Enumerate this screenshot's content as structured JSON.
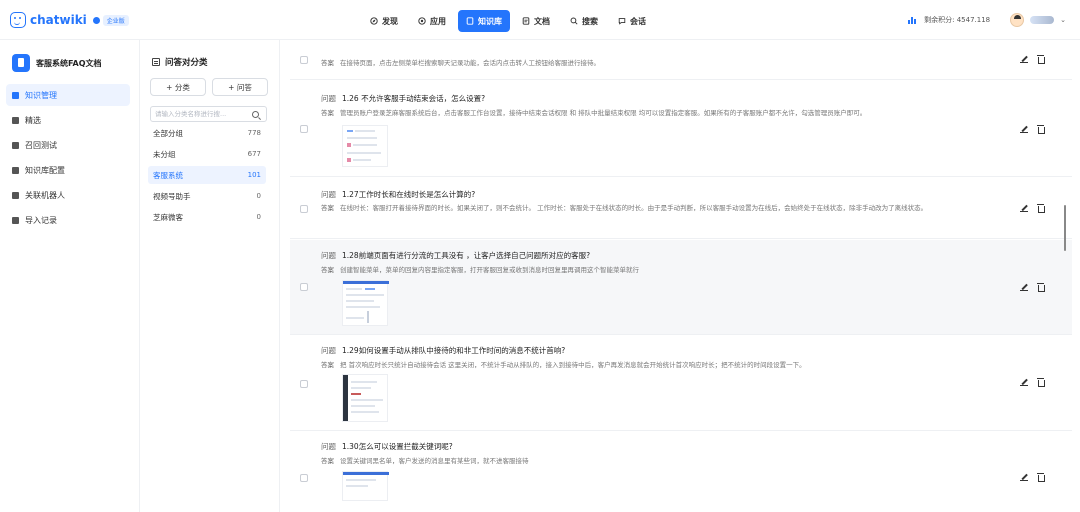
{
  "header": {
    "brand": "chatwiki",
    "version_badge": "企业版",
    "nav": [
      {
        "label": "发现",
        "icon": "discover-icon",
        "active": false
      },
      {
        "label": "应用",
        "icon": "app-icon",
        "active": false
      },
      {
        "label": "知识库",
        "icon": "knowledge-icon",
        "active": true
      },
      {
        "label": "文档",
        "icon": "document-icon",
        "active": false
      },
      {
        "label": "搜索",
        "icon": "search-icon",
        "active": false
      },
      {
        "label": "会话",
        "icon": "chat-icon",
        "active": false
      }
    ],
    "points_label": "剩余积分: 4547.118"
  },
  "sidebar": {
    "library_title": "客服系统FAQ文档",
    "items": [
      {
        "label": "知识管理",
        "active": true
      },
      {
        "label": "精选",
        "active": false
      },
      {
        "label": "召回测试",
        "active": false
      },
      {
        "label": "知识库配置",
        "active": false
      },
      {
        "label": "关联机器人",
        "active": false
      },
      {
        "label": "导入记录",
        "active": false
      }
    ]
  },
  "categories": {
    "title": "问答对分类",
    "add_category": "+ 分类",
    "add_qa": "+ 问答",
    "search_placeholder": "请输入分类名称进行搜...",
    "items": [
      {
        "name": "全部分组",
        "count": "778",
        "active": false
      },
      {
        "name": "未分组",
        "count": "677",
        "active": false
      },
      {
        "name": "客服系统",
        "count": "101",
        "active": true
      },
      {
        "name": "视频号助手",
        "count": "0",
        "active": false
      },
      {
        "name": "芝麻微客",
        "count": "0",
        "active": false
      }
    ]
  },
  "qa_list": {
    "question_tag": "问题",
    "answer_tag": "答案",
    "items": [
      {
        "question": "",
        "answer": "在接待页面，点击左侧菜单栏搜索聊天记录功能，会话内点击转人工按钮给客服进行接待。"
      },
      {
        "question": "1.26 不允许客服手动结束会话，怎么设置?",
        "answer": "管理员账户登录芝麻客服系统后台，点击客服工作台设置，接待中结束会话权限 和 排队中批量结束权限 均可以设置指定客服。如果所有的子客服账户都不允许，勾选管理员账户即可。"
      },
      {
        "question": "1.27工作时长和在线时长是怎么计算的?",
        "answer": "在线时长：客服打开着接待界面的时长。如果关闭了，则不会统计。 工作时长：客服处于在线状态的时长。由于是手动判断，所以客服手动设置为在线后，会始终处于在线状态，除非手动改为了离线状态。"
      },
      {
        "question": "1.28前端页面有进行分流的工具没有 ，让客户选择自己问题所对应的客服?",
        "answer": "创建智能菜单，菜单的回复内容里指定客服，打开客服回复或收到消息时回复里再调用这个智能菜单就行"
      },
      {
        "question": "1.29如何设置手动从排队中接待的和非工作时间的消息不统计首响?",
        "answer": "把 首次响应时长只统计自动接待会话 这里关闭，不统计手动从排队的，接入到接待中后，客户再发消息就会开始统计首次响应时长；把不统计的时间段设置一下。"
      },
      {
        "question": "1.30怎么可以设置拦截关键词呢?",
        "answer": "设置关键词黑名单，客户发送的消息里有某些词，就不进客服接待"
      }
    ]
  }
}
